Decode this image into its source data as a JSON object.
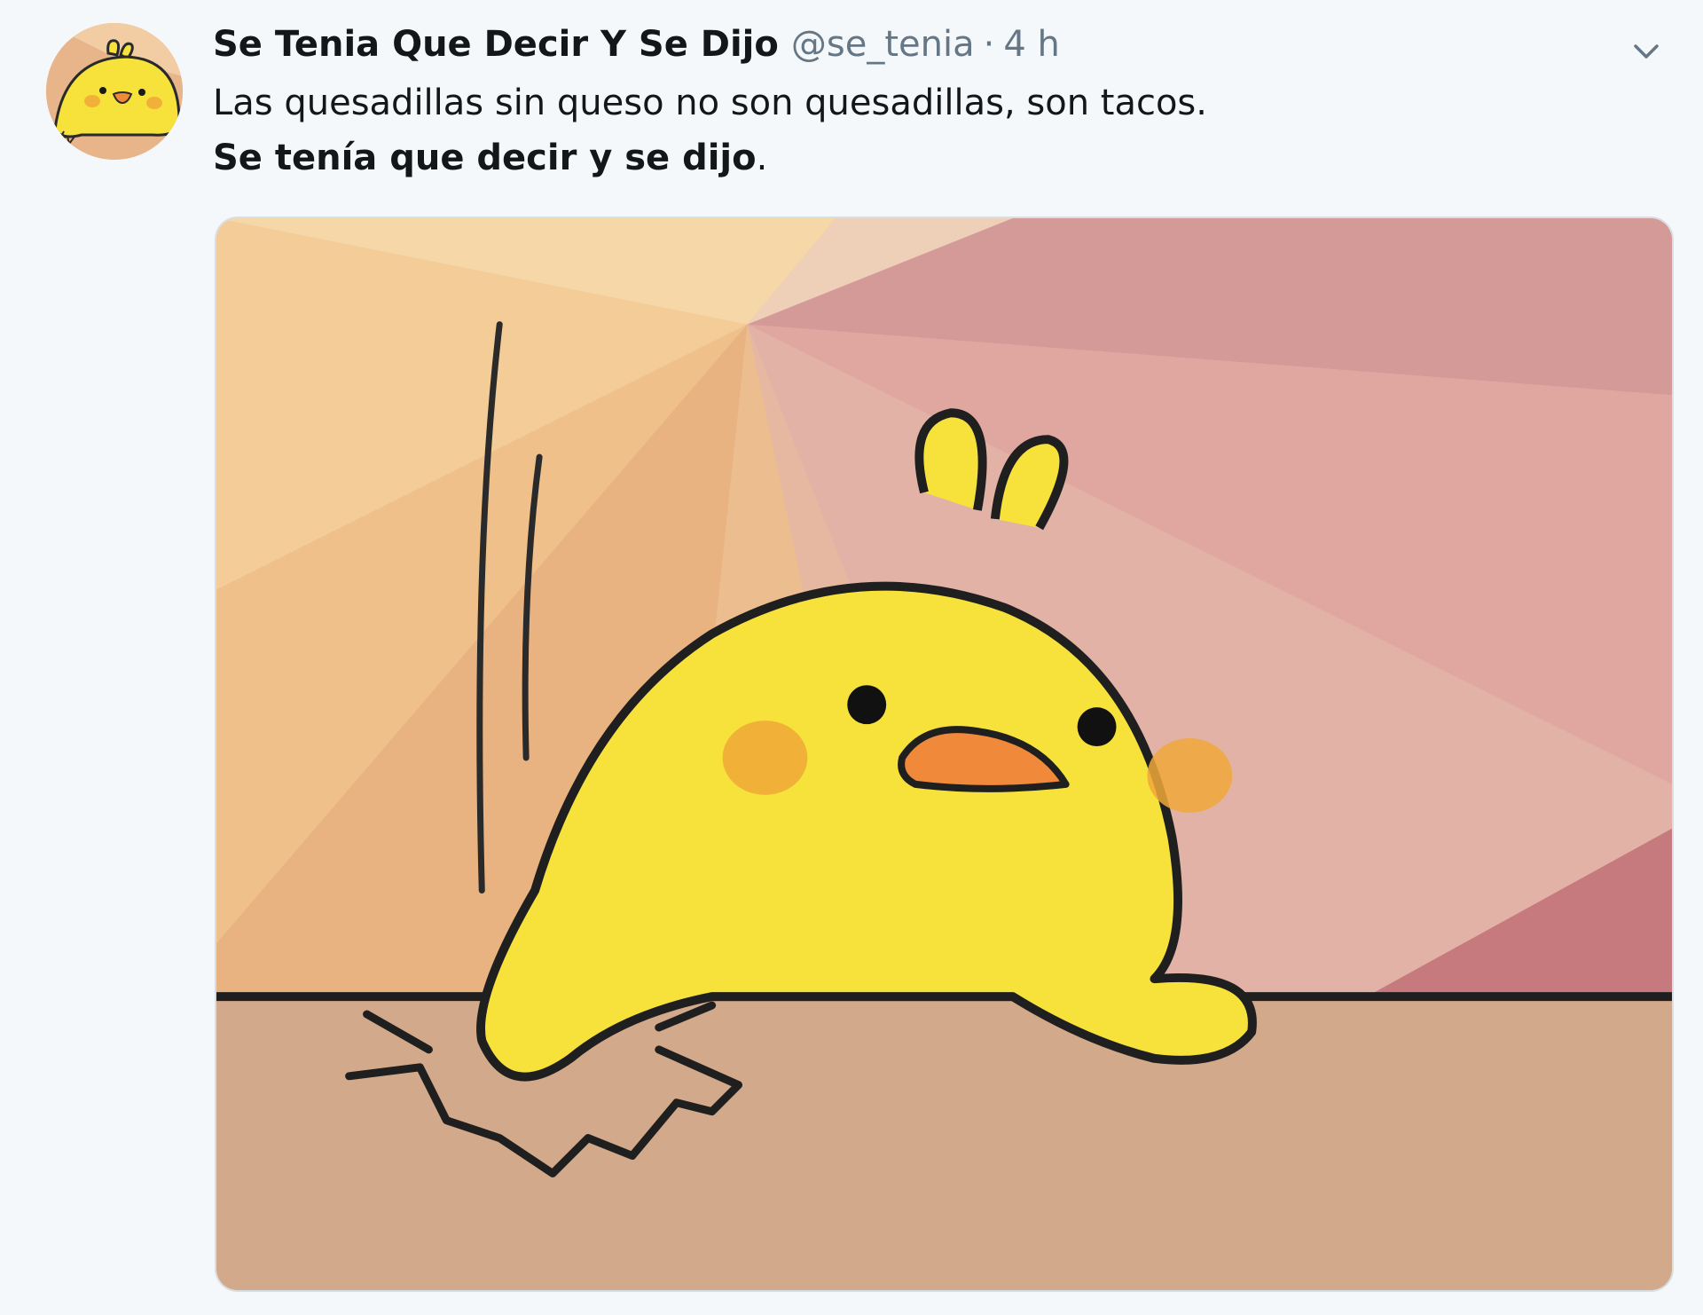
{
  "tweet": {
    "display_name": "Se Tenia Que Decir Y Se Dijo",
    "handle": "@se_tenia",
    "separator": "·",
    "time": "4 h",
    "text_line1": "Las quesadillas sin queso no son quesadillas, son tacos.",
    "text_line2_bold": "Se tenía que decir y se dijo",
    "text_line2_tail": ".",
    "avatar_icon": "yellow-chick-avatar",
    "menu_icon": "chevron-down-icon",
    "media_image": "yellow-chick-slamming-table"
  },
  "colors": {
    "background": "#f5f8fa",
    "text_primary": "#14171a",
    "text_secondary": "#657786",
    "chick_yellow": "#f7e23b",
    "cheek_orange": "#f0a83a",
    "beak_orange": "#f08a3a",
    "table_tan": "#d2a98a"
  }
}
